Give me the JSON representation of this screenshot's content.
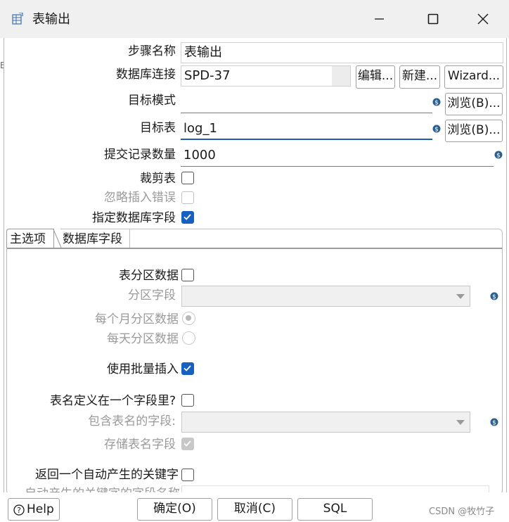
{
  "window": {
    "title": "表输出",
    "controls": [
      "minimize",
      "maximize",
      "close"
    ]
  },
  "form": {
    "step_name": {
      "label": "步骤名称",
      "value": "表输出"
    },
    "db_connection": {
      "label": "数据库连接",
      "value": "SPD-37",
      "edit_btn": "编辑...",
      "new_btn": "新建...",
      "wizard_btn": "Wizard..."
    },
    "target_schema": {
      "label": "目标模式",
      "value": "",
      "browse_btn": "浏览(B)..."
    },
    "target_table": {
      "label": "目标表",
      "value": "log_1",
      "browse_btn": "浏览(B)..."
    },
    "commit_size": {
      "label": "提交记录数量",
      "value": "1000"
    },
    "truncate_table": {
      "label": "裁剪表",
      "checked": false
    },
    "ignore_insert_errors": {
      "label": "忽略插入错误",
      "checked": false,
      "disabled": true
    },
    "specify_db_fields": {
      "label": "指定数据库字段",
      "checked": true
    }
  },
  "tabs": [
    {
      "label": "主选项",
      "active": true
    },
    {
      "label": "数据库字段",
      "active": false
    }
  ],
  "main_options": {
    "partition_data": {
      "label": "表分区数据",
      "checked": false
    },
    "partition_field": {
      "label": "分区字段",
      "value": "",
      "disabled": true
    },
    "partition_monthly": {
      "label": "每个月分区数据",
      "selected": true,
      "disabled": true
    },
    "partition_daily": {
      "label": "每天分区数据",
      "selected": false,
      "disabled": true
    },
    "use_batch_insert": {
      "label": "使用批量插入",
      "checked": true
    },
    "table_name_in_field": {
      "label": "表名定义在一个字段里?",
      "checked": false
    },
    "table_name_field": {
      "label": "包含表名的字段:",
      "value": "",
      "disabled": true
    },
    "store_table_name_field": {
      "label": "存储表名字段",
      "checked": true,
      "disabled": true
    },
    "return_generated_key": {
      "label": "返回一个自动产生的关键字",
      "checked": false
    },
    "generated_key_field": {
      "label": "自动产生的关键字的字段名称",
      "value": "",
      "disabled": true
    }
  },
  "footer": {
    "help_btn": "Help",
    "ok_btn": "确定(O)",
    "cancel_btn": "取消(C)",
    "sql_btn": "SQL"
  },
  "watermark": "CSDN @牧竹子",
  "colors": {
    "accent": "#1560c0",
    "title_bar": "#f0f0f0",
    "disabled_text": "#9a9a9a"
  }
}
